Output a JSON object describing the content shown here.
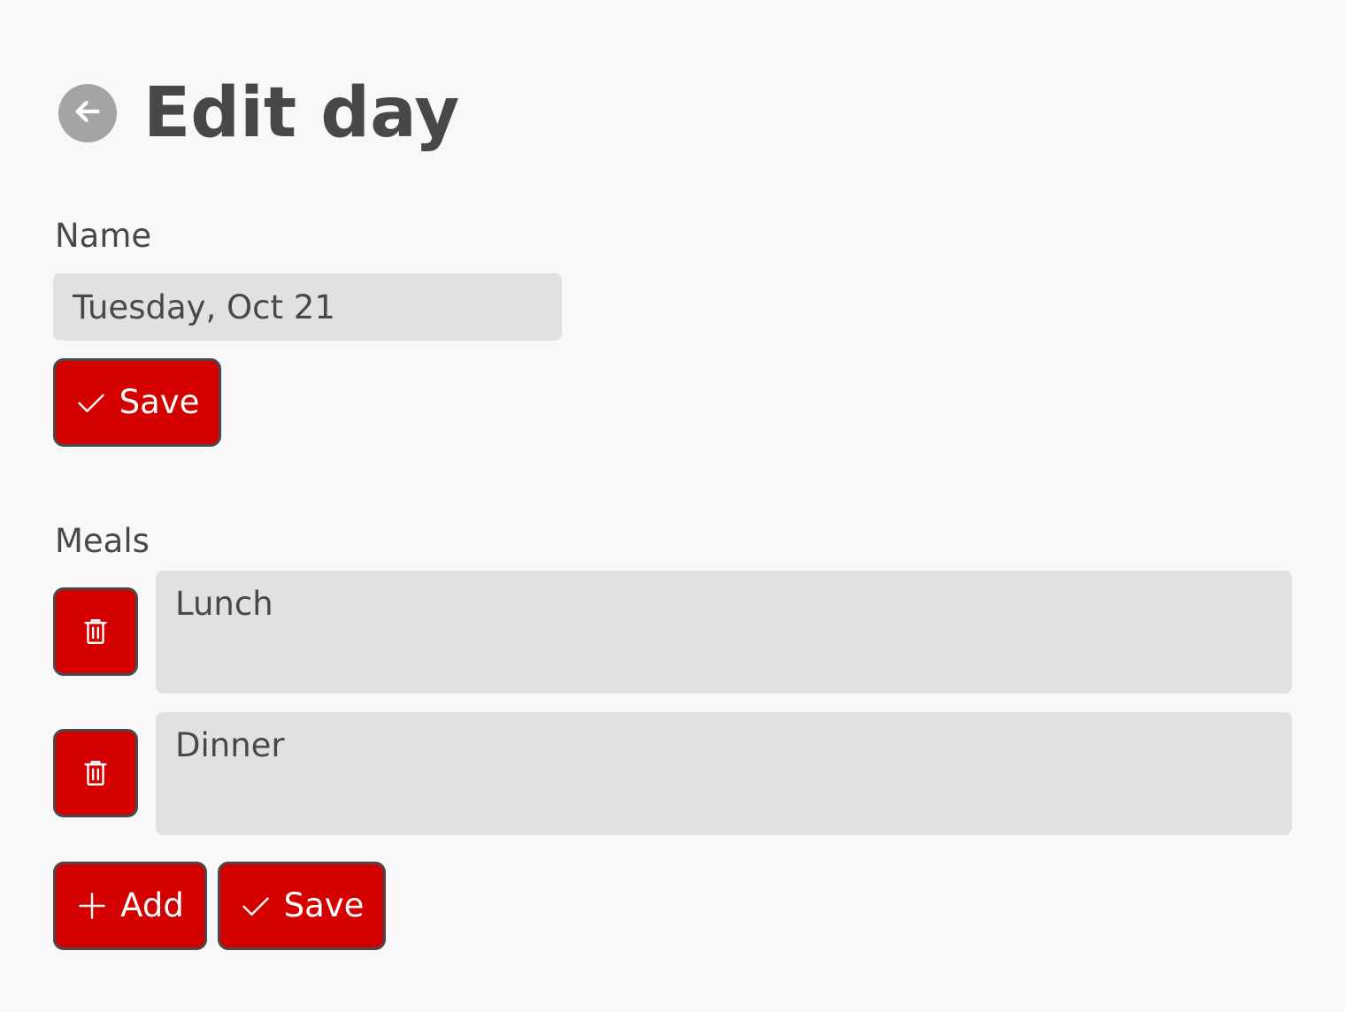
{
  "header": {
    "title": "Edit day",
    "back_icon": "arrow-left-icon"
  },
  "name_section": {
    "label": "Name",
    "value": "Tuesday, Oct 21",
    "save_label": "Save",
    "save_icon": "check-icon"
  },
  "meals_section": {
    "label": "Meals",
    "items": [
      {
        "value": "Lunch",
        "delete_icon": "trash-icon"
      },
      {
        "value": "Dinner",
        "delete_icon": "trash-icon"
      }
    ],
    "add_label": "Add",
    "add_icon": "plus-icon",
    "save_label": "Save",
    "save_icon": "check-icon"
  },
  "colors": {
    "accent": "#d40000",
    "text": "#484848",
    "input_bg": "#e1e1e1",
    "page_bg": "#f8f8f8",
    "back_button_bg": "#a4a4a4"
  }
}
